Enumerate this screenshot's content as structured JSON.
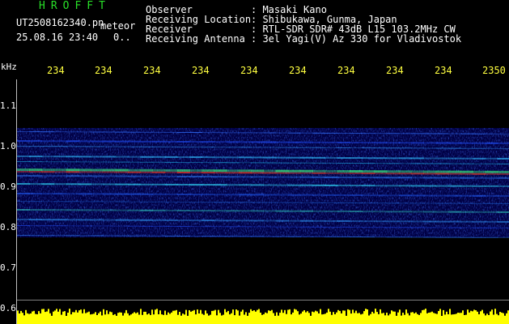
{
  "header": {
    "logo": "HROFFT",
    "filename": "UT2508162340.pn",
    "mode": "meteor",
    "datetime": "25.08.16 23:40",
    "dots": "0..",
    "info": [
      {
        "key": "Observer",
        "value": ": Masaki Kano"
      },
      {
        "key": "Receiving Location",
        "value": ": Shibukawa, Gunma, Japan"
      },
      {
        "key": "Receiver",
        "value": ": RTL-SDR SDR# 43dB L15 103.2MHz CW"
      },
      {
        "key": "Receiving Antenna",
        "value": ": 3el Yagi(V) Az 330 for Vladivostok"
      }
    ]
  },
  "axis": {
    "y_unit": "kHz",
    "y_ticks": [
      "1.1",
      "1.0",
      "0.9",
      "0.8",
      "0.7",
      "0.6"
    ],
    "x_ticks": [
      "234",
      "234",
      "234",
      "234",
      "234",
      "234",
      "234",
      "234",
      "234",
      "2350"
    ]
  },
  "colors": {
    "background": "#000000",
    "logo": "#28e028",
    "tick_labels": "#ffff40",
    "signal_band": "#ff3030",
    "noise_bar": "#ffff00"
  }
}
